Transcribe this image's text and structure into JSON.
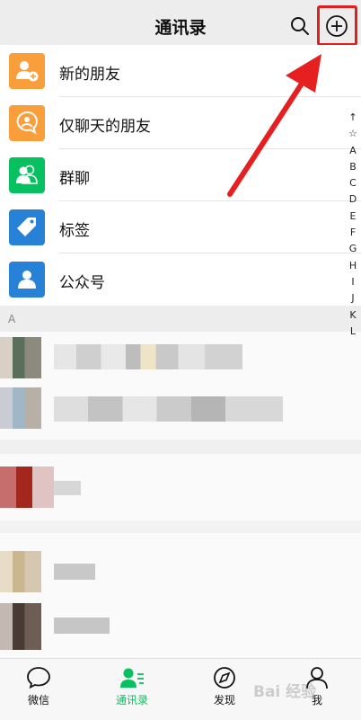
{
  "header": {
    "title": "通讯录"
  },
  "menu": [
    {
      "label": "新的朋友",
      "icon": "add-friend-icon",
      "color": "#fa9d3b"
    },
    {
      "label": "仅聊天的朋友",
      "icon": "chat-only-friend-icon",
      "color": "#fa9d3b"
    },
    {
      "label": "群聊",
      "icon": "group-chat-icon",
      "color": "#07c160"
    },
    {
      "label": "标签",
      "icon": "tag-icon",
      "color": "#2782d7"
    },
    {
      "label": "公众号",
      "icon": "official-account-icon",
      "color": "#2782d7"
    }
  ],
  "section": {
    "letter": "A"
  },
  "index_letters": [
    "↑",
    "☆",
    "A",
    "B",
    "C",
    "D",
    "E",
    "F",
    "G",
    "H",
    "I",
    "J",
    "K",
    "L"
  ],
  "tabs": [
    {
      "label": "微信",
      "icon": "chat-bubble-icon",
      "active": false
    },
    {
      "label": "通讯录",
      "icon": "contacts-icon",
      "active": true
    },
    {
      "label": "发现",
      "icon": "compass-icon",
      "active": false
    },
    {
      "label": "我",
      "icon": "person-icon",
      "active": false
    }
  ],
  "watermark": "Bai 经验",
  "colors": {
    "accent": "#07c160",
    "highlight": "#e02020",
    "orange": "#fa9d3b",
    "blue": "#2782d7"
  }
}
